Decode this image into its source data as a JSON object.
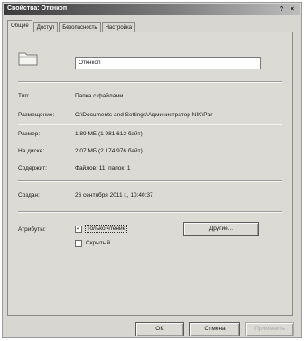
{
  "window": {
    "title": "Свойства: Откнкоп",
    "help_symbol": "?",
    "close_symbol": "×"
  },
  "tabs": [
    {
      "label": "Общие"
    },
    {
      "label": "Доступ"
    },
    {
      "label": "Безопасность"
    },
    {
      "label": "Настройка"
    }
  ],
  "folder": {
    "icon": "folder-icon",
    "name": "Откнкоп"
  },
  "properties": {
    "type_label": "Тип:",
    "type_value": "Папка с файлами",
    "location_label": "Размещение:",
    "location_value": "C:\\Documents and Settings\\Администратор NIK\\Par",
    "size_label": "Размер:",
    "size_value": "1,89 МБ (1 981 612 байт)",
    "ondisk_label": "На диске:",
    "ondisk_value": "2,07 МБ (2 174 976 байт)",
    "contains_label": "Содержит:",
    "contains_value": "Файлов: 11; папок: 1",
    "created_label": "Создан:",
    "created_value": "26 сентября 2011 г., 10:40:37",
    "attributes_label": "Атрибуты:"
  },
  "attributes": {
    "readonly_label": "Только чтение",
    "readonly_checked": true,
    "hidden_label": "Скрытый",
    "hidden_checked": false,
    "other_button": "Другие..."
  },
  "buttons": {
    "ok": "OK",
    "cancel": "Отмена",
    "apply": "Применить"
  }
}
